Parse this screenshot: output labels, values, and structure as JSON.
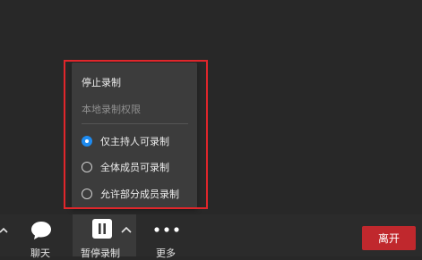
{
  "recording_menu": {
    "stop_recording": "停止录制",
    "local_permission_label": "本地录制权限",
    "options": [
      {
        "label": "仅主持人可录制",
        "selected": true
      },
      {
        "label": "全体成员可录制",
        "selected": false
      },
      {
        "label": "允许部分成员录制",
        "selected": false
      }
    ]
  },
  "toolbar": {
    "chat_label": "聊天",
    "pause_recording_label": "暂停录制",
    "more_label": "更多",
    "leave_label": "离开"
  },
  "colors": {
    "highlight_border": "#e0262b",
    "radio_selected": "#1e8bf0",
    "leave_button": "#c0282d"
  },
  "icons": {
    "chat": "speech-bubble",
    "pause": "pause-bars",
    "more": "three-dots",
    "expand": "chevron-up"
  }
}
